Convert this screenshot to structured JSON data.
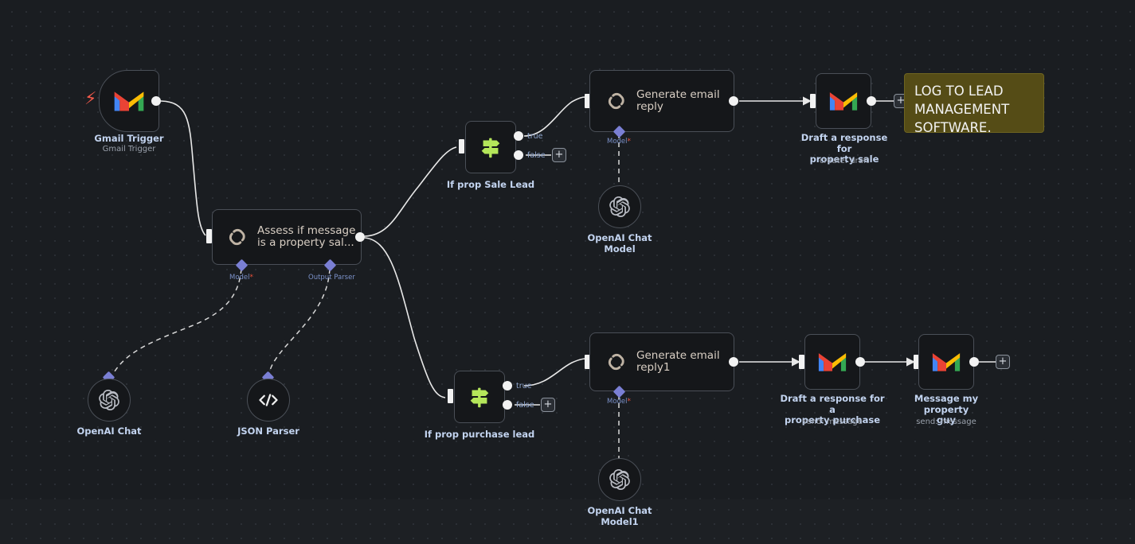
{
  "app": {
    "name": "n8n-workflow-canvas",
    "theme": "dark"
  },
  "colors": {
    "canvas_bg": "#1a1d21",
    "node_bg": "#15171a",
    "node_border": "#4a4f57",
    "node_text": "#d9cfc4",
    "label_text": "#c3d4f0",
    "sublabel_text": "#9aa1ac",
    "sticky_bg": "#554c16",
    "sticky_border": "#6e6420",
    "if_icon_green": "#b4e65a",
    "connector_diamond": "#7a7fd4",
    "required_star": "#e8503a",
    "trigger_bolt": "#f0594a",
    "edge": "#e8e8e8"
  },
  "nodes": [
    {
      "id": "gmail-trigger",
      "title": "Gmail Trigger",
      "subtitle": "Gmail Trigger",
      "icon": "gmail-icon",
      "kind": "trigger"
    },
    {
      "id": "assess-message",
      "title": "Assess if message is a property sal...",
      "text": "Assess if message\nis a property sal...",
      "icon": "chain-link-icon",
      "kind": "chain",
      "connectors": [
        {
          "label": "Model",
          "required": true
        },
        {
          "label": "Output Parser",
          "required": false
        }
      ]
    },
    {
      "id": "if-prop-sale-lead",
      "title": "If prop Sale Lead",
      "icon": "signpost-icon",
      "kind": "if",
      "outputs": [
        "true",
        "false"
      ]
    },
    {
      "id": "generate-email-reply",
      "title": "Generate email reply",
      "text": "Generate email\nreply",
      "icon": "chain-link-icon",
      "kind": "chain",
      "connectors": [
        {
          "label": "Model",
          "required": true
        }
      ]
    },
    {
      "id": "draft-response-property-sale",
      "title": "Draft a response for\nproperty sale",
      "subtitle": "create: draft",
      "icon": "gmail-icon",
      "kind": "action"
    },
    {
      "id": "if-prop-purchase-lead",
      "title": "If prop purchase lead",
      "icon": "signpost-icon",
      "kind": "if",
      "outputs": [
        "true",
        "false"
      ]
    },
    {
      "id": "generate-email-reply1",
      "title": "Generate email reply1",
      "text": "Generate email\nreply1",
      "icon": "chain-link-icon",
      "kind": "chain",
      "connectors": [
        {
          "label": "Model",
          "required": true
        }
      ]
    },
    {
      "id": "draft-response-property-purchase",
      "title": "Draft a response for a\nproperty purchase",
      "subtitle": "send: message",
      "icon": "gmail-icon",
      "kind": "action"
    },
    {
      "id": "message-my-property-guy",
      "title": "Message my property\nguy",
      "subtitle": "send: message",
      "icon": "gmail-icon",
      "kind": "action"
    },
    {
      "id": "openai-chat",
      "title": "OpenAI Chat",
      "icon": "openai-icon",
      "kind": "sub"
    },
    {
      "id": "json-parser",
      "title": "JSON Parser",
      "icon": "code-brackets-icon",
      "kind": "sub"
    },
    {
      "id": "openai-chat-model",
      "title": "OpenAI Chat\nModel",
      "icon": "openai-icon",
      "kind": "sub"
    },
    {
      "id": "openai-chat-model1",
      "title": "OpenAI Chat\nModel1",
      "icon": "openai-icon",
      "kind": "sub"
    }
  ],
  "labels": {
    "gmail_trigger_title": "Gmail Trigger",
    "gmail_trigger_sub": "Gmail Trigger",
    "assess_text": "Assess if message\nis a property sal...",
    "assess_model": "Model",
    "assess_output_parser": "Output Parser",
    "if_sale_title": "If prop Sale Lead",
    "if_sale_true": "true",
    "if_sale_false": "false",
    "gen_reply_text": "Generate email\nreply",
    "gen_reply_model": "Model",
    "draft_sale_title": "Draft a response for\nproperty sale",
    "draft_sale_sub": "create: draft",
    "if_purchase_title": "If prop purchase lead",
    "if_purchase_true": "true",
    "if_purchase_false": "false",
    "gen_reply1_text": "Generate email\nreply1",
    "gen_reply1_model": "Model",
    "draft_purchase_title": "Draft a response for a\nproperty purchase",
    "draft_purchase_sub": "send: message",
    "message_guy_title": "Message my property\nguy",
    "message_guy_sub": "send: message",
    "openai_chat_title": "OpenAI Chat",
    "json_parser_title": "JSON Parser",
    "openai_model_title": "OpenAI Chat\nModel",
    "openai_model1_title": "OpenAI Chat\nModel1",
    "plus": "+"
  },
  "sticky_notes": [
    {
      "id": "lead-management-note",
      "text": "LOG TO LEAD MANAGEMENT SOFTWARE,"
    }
  ]
}
